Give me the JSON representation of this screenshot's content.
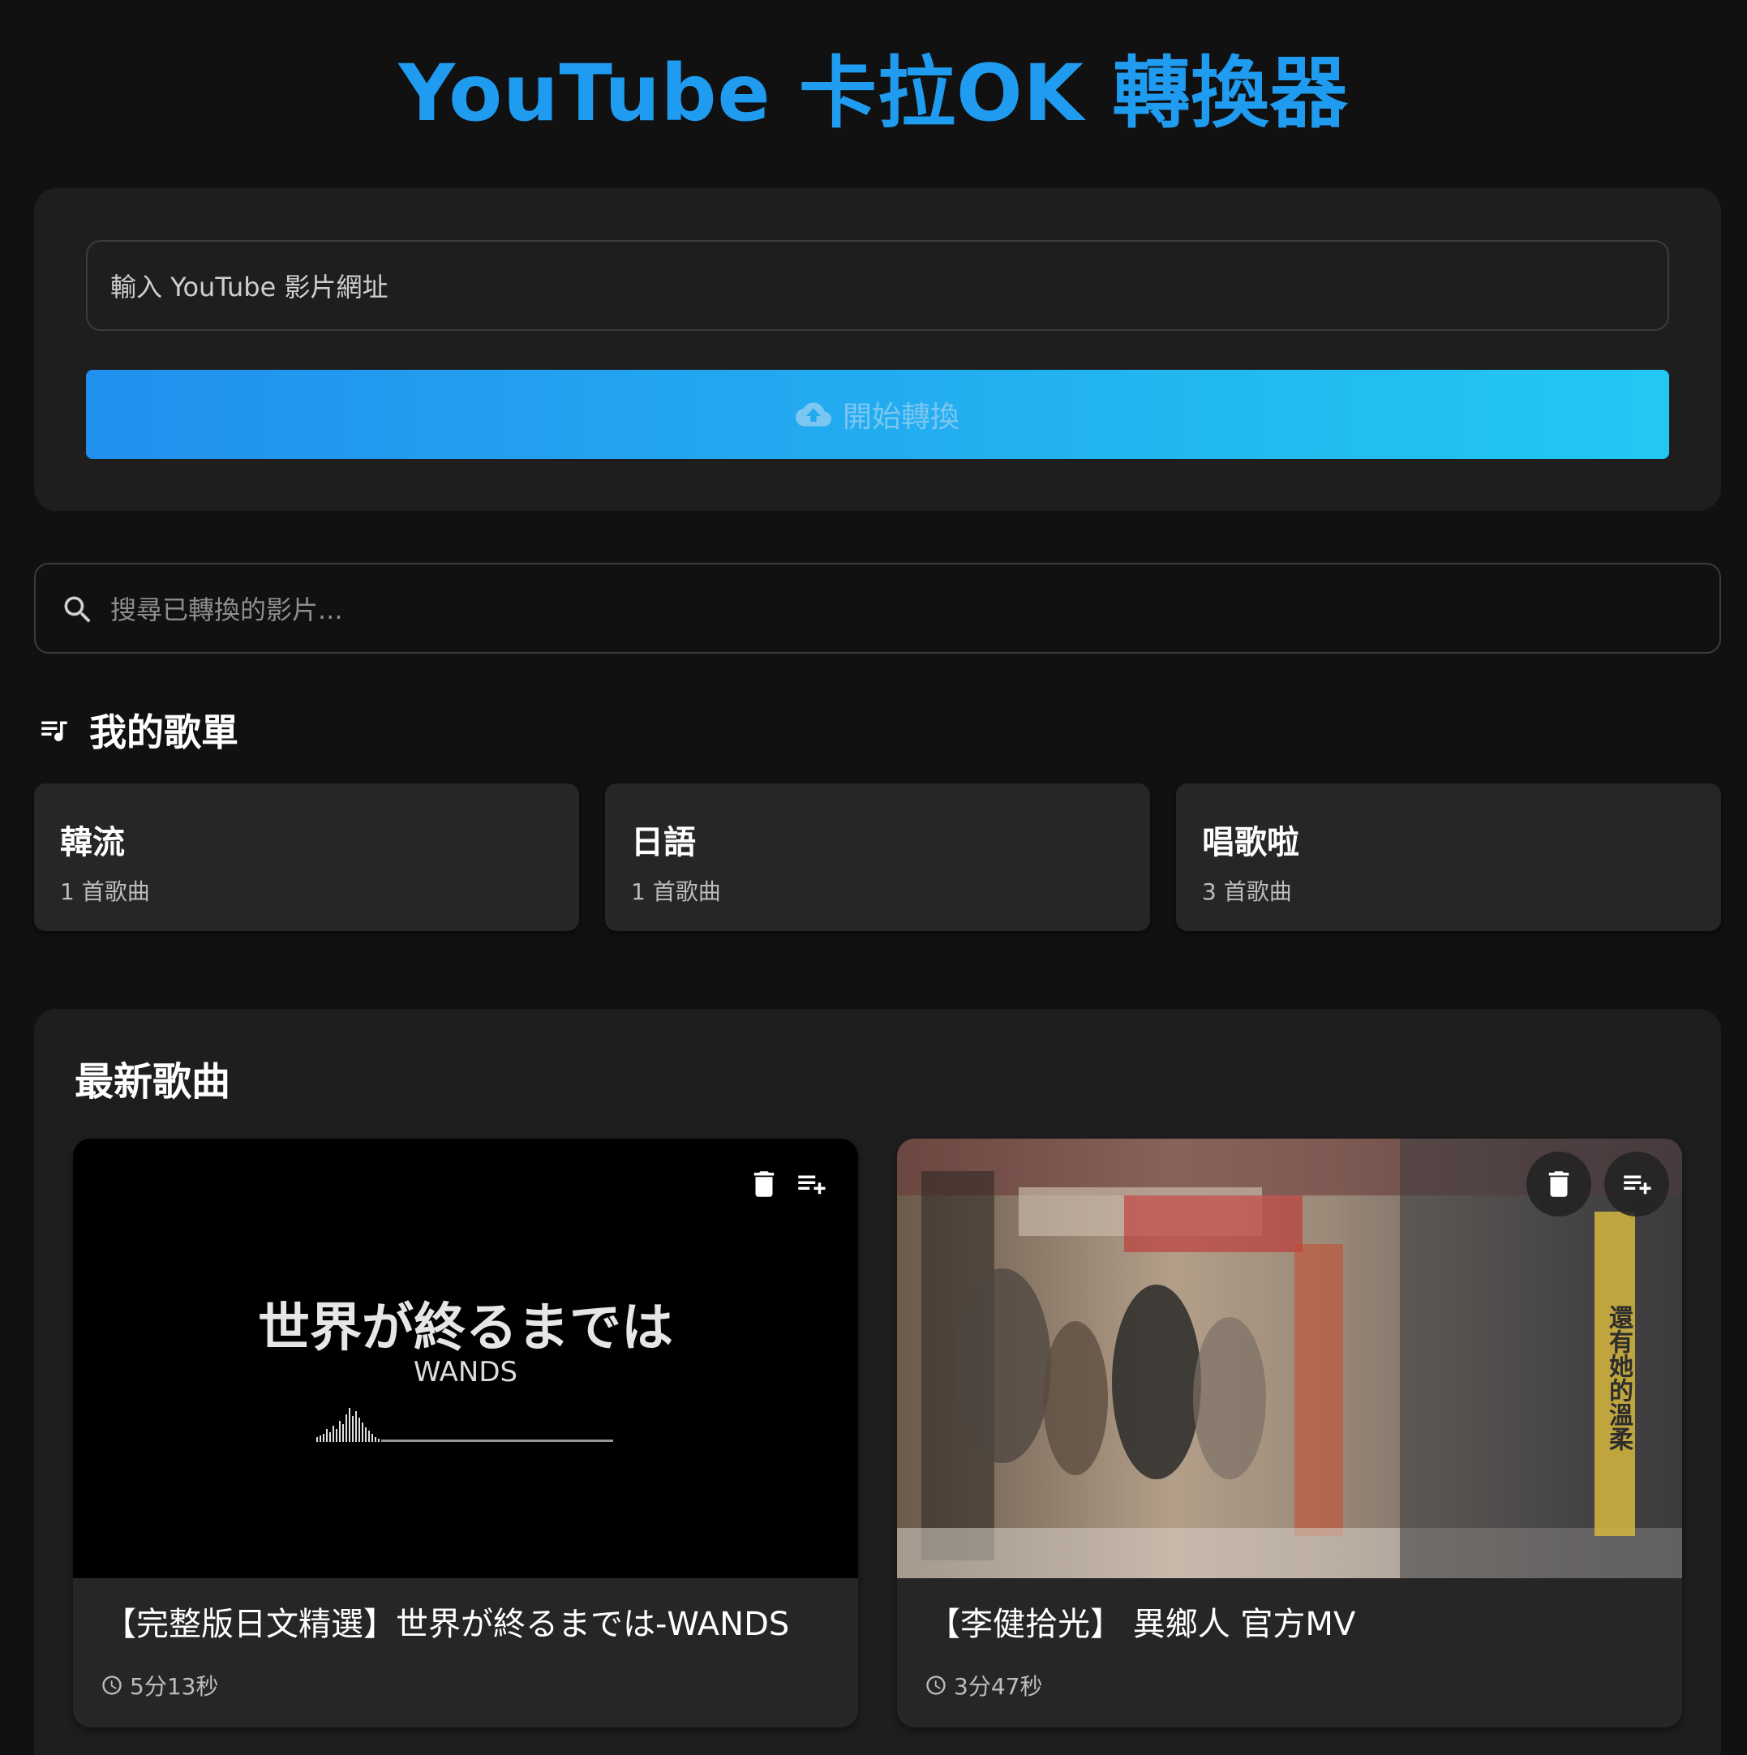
{
  "app": {
    "title": "YouTube 卡拉OK 轉換器",
    "accent_color": "#1f9bf0"
  },
  "converter": {
    "url_placeholder": "輸入 YouTube 影片網址",
    "convert_label": "開始轉換",
    "convert_icon": "cloud-upload-icon",
    "button_gradient": [
      "#2290ee",
      "#22c8f2"
    ]
  },
  "search": {
    "icon": "search-icon",
    "placeholder": "搜尋已轉換的影片..."
  },
  "playlists": {
    "icon": "playlist-music-icon",
    "heading": "我的歌單",
    "items": [
      {
        "name": "韓流",
        "count": "1 首歌曲"
      },
      {
        "name": "日語",
        "count": "1 首歌曲"
      },
      {
        "name": "唱歌啦",
        "count": "3 首歌曲"
      }
    ]
  },
  "latest": {
    "heading": "最新歌曲",
    "songs": [
      {
        "name": "【完整版日文精選】世界が終るまでは-WANDS",
        "duration": "5分13秒",
        "thumb_title": "世界が終るまでは",
        "thumb_artist": "WANDS",
        "delete_icon": "trash-icon",
        "add_icon": "playlist-add-icon"
      },
      {
        "name": "【李健拾光】 異鄉人 官方MV",
        "duration": "3分47秒",
        "thumb_sign": "還有她的溫柔",
        "delete_icon": "trash-icon",
        "add_icon": "playlist-add-icon"
      }
    ]
  }
}
